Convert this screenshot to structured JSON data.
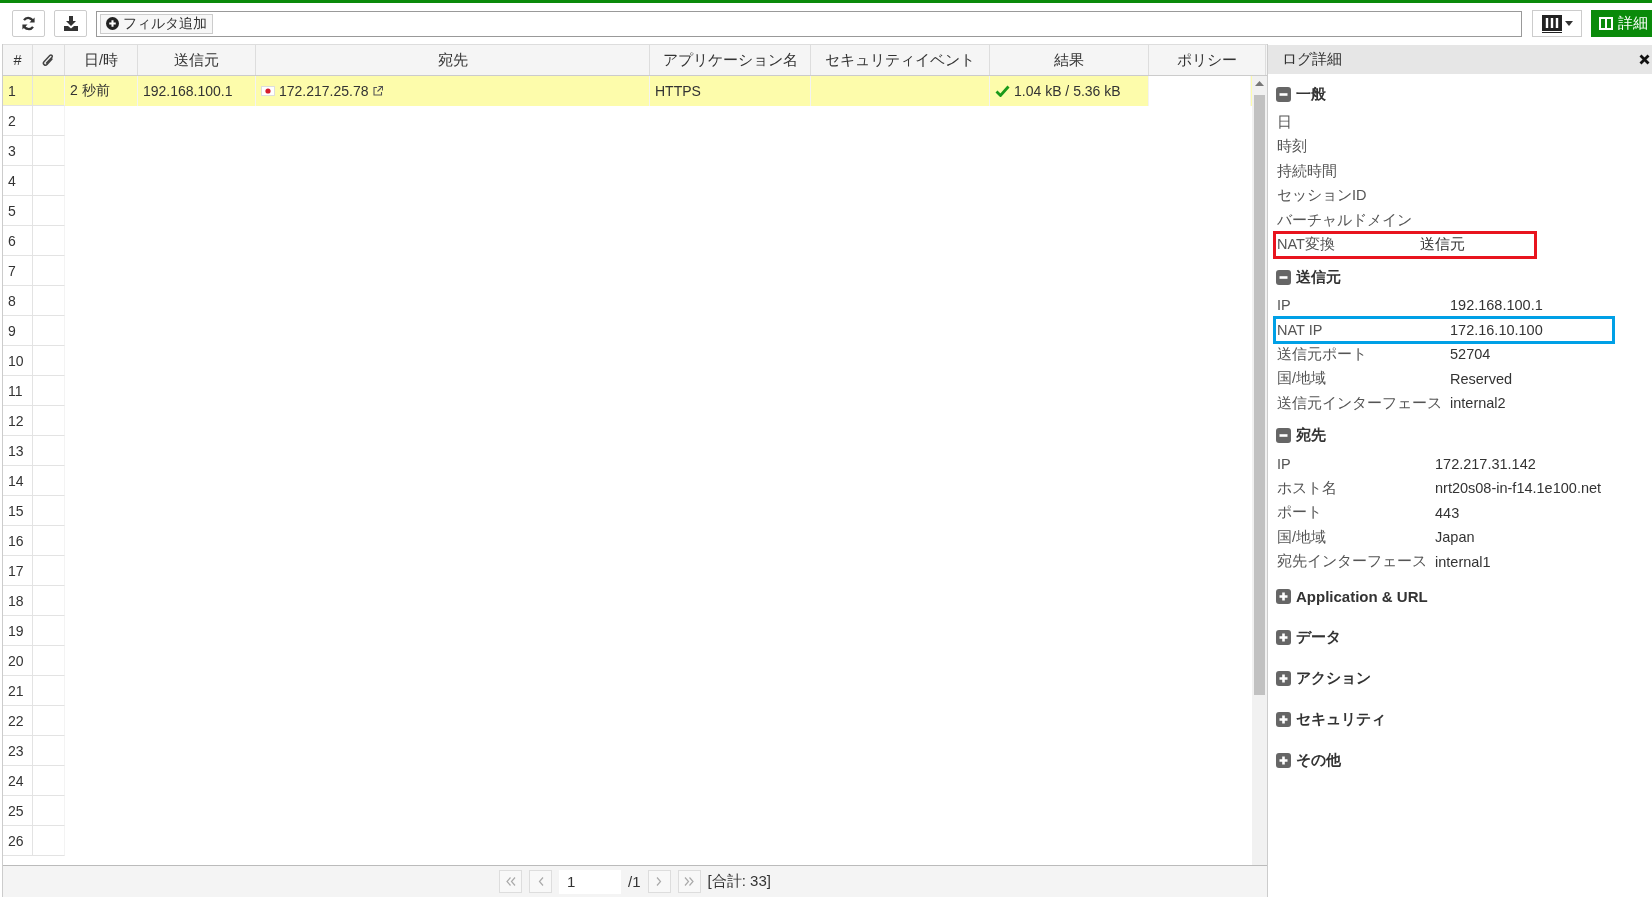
{
  "toolbar": {
    "filter_button": "フィルタ追加",
    "details_button": "詳細"
  },
  "table": {
    "columns": [
      {
        "kind": "text",
        "label": "#"
      },
      {
        "kind": "attachment"
      },
      {
        "kind": "text",
        "label": "日/時"
      },
      {
        "kind": "text",
        "label": "送信元"
      },
      {
        "kind": "text",
        "label": "宛先"
      },
      {
        "kind": "text",
        "label": "アプリケーション名"
      },
      {
        "kind": "text",
        "label": "セキュリティイベント"
      },
      {
        "kind": "text",
        "label": "結果"
      },
      {
        "kind": "text",
        "label": "ポリシー"
      }
    ],
    "rows": [
      {
        "selected": true,
        "number": "1",
        "time": "2 秒前",
        "source": "192.168.100.1",
        "destination": "172.217.25.78",
        "application": "HTTPS",
        "result": "1.04 kB / 5.36 kB",
        "succeeded": true
      },
      {
        "selected": false,
        "number": "2"
      },
      {
        "selected": false,
        "number": "3"
      },
      {
        "selected": false,
        "number": "4"
      },
      {
        "selected": false,
        "number": "5"
      },
      {
        "selected": false,
        "number": "6"
      },
      {
        "selected": false,
        "number": "7"
      },
      {
        "selected": false,
        "number": "8"
      },
      {
        "selected": false,
        "number": "9"
      },
      {
        "selected": false,
        "number": "10"
      },
      {
        "selected": false,
        "number": "11"
      },
      {
        "selected": false,
        "number": "12"
      },
      {
        "selected": false,
        "number": "13"
      },
      {
        "selected": false,
        "number": "14"
      },
      {
        "selected": false,
        "number": "15"
      },
      {
        "selected": false,
        "number": "16"
      },
      {
        "selected": false,
        "number": "17"
      },
      {
        "selected": false,
        "number": "18"
      },
      {
        "selected": false,
        "number": "19"
      },
      {
        "selected": false,
        "number": "20"
      },
      {
        "selected": false,
        "number": "21"
      },
      {
        "selected": false,
        "number": "22"
      },
      {
        "selected": false,
        "number": "23"
      },
      {
        "selected": false,
        "number": "24"
      },
      {
        "selected": false,
        "number": "25"
      },
      {
        "selected": false,
        "number": "26"
      }
    ]
  },
  "pagination": {
    "page": "1",
    "page_count": "/1",
    "total": "[合計: 33]"
  },
  "log_details": {
    "title": "ログ詳細",
    "sections": [
      {
        "title": "一般",
        "expanded": true,
        "rows": [
          {
            "label": "日"
          },
          {
            "label": "時刻"
          },
          {
            "label": "持続時間"
          },
          {
            "label": "セッションID"
          },
          {
            "label": "バーチャルドメイン"
          },
          {
            "label": "NAT変換",
            "value": "送信元",
            "color": "#e8141e"
          }
        ]
      },
      {
        "title": "送信元",
        "expanded": true,
        "rows": [
          {
            "label": "IP",
            "value": "192.168.100.1"
          },
          {
            "label": "NAT IP",
            "value": "172.16.10.100",
            "color": "#00a0e6"
          },
          {
            "label": "送信元ポート",
            "value": "52704"
          },
          {
            "label": "国/地域",
            "value": "Reserved"
          },
          {
            "label": "送信元インターフェース",
            "value": "internal2"
          }
        ]
      },
      {
        "title": "宛先",
        "expanded": true,
        "rows": [
          {
            "label": "IP",
            "value": "172.217.31.142"
          },
          {
            "label": "ホスト名",
            "value": "nrt20s08-in-f14.1e100.net"
          },
          {
            "label": "ポート",
            "value": "443"
          },
          {
            "label": "国/地域",
            "value": "Japan"
          },
          {
            "label": "宛先インターフェース",
            "value": "internal1"
          }
        ]
      },
      {
        "title": "Application & URL",
        "expanded": false
      },
      {
        "title": "データ",
        "expanded": false
      },
      {
        "title": "アクション",
        "expanded": false
      },
      {
        "title": "セキュリティ",
        "expanded": false
      },
      {
        "title": "その他",
        "expanded": false
      }
    ]
  }
}
